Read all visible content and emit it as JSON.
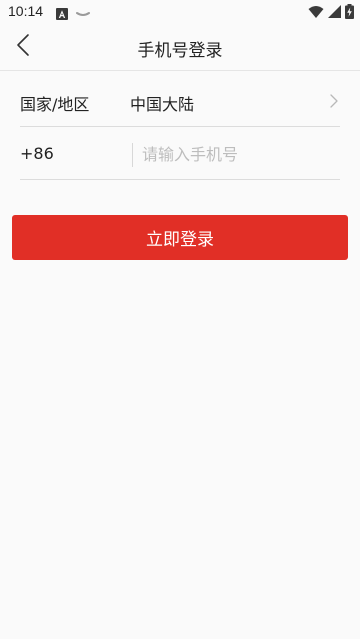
{
  "status_bar": {
    "time": "10:14",
    "icons": [
      "android-a-icon",
      "notification-dash-icon",
      "wifi-icon",
      "cellular-signal-icon",
      "battery-charging-icon"
    ]
  },
  "app_bar": {
    "title": "手机号登录",
    "back_icon": "chevron-left-icon"
  },
  "form": {
    "region_label": "国家/地区",
    "region_value": "中国大陆",
    "region_chevron_icon": "chevron-right-icon",
    "country_code": "+86",
    "phone_value": "",
    "phone_placeholder": "请输入手机号"
  },
  "actions": {
    "login_label": "立即登录"
  },
  "colors": {
    "accent": "#e12f26",
    "background": "#fafafa",
    "divider": "#dcdcdc",
    "placeholder": "#bdbdbd",
    "text": "#222222"
  }
}
